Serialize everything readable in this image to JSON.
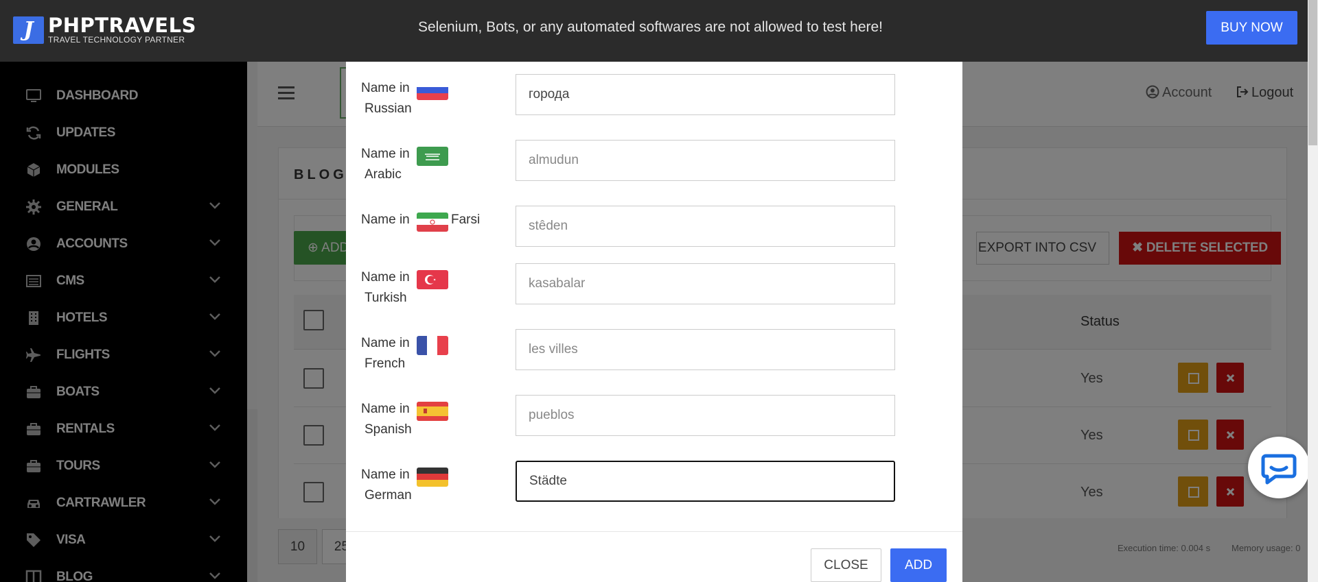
{
  "topbar": {
    "logo_glyph": "J",
    "brand": "PHPTRAVELS",
    "tagline": "TRAVEL TECHNOLOGY PARTNER",
    "notice": "Selenium, Bots, or any automated softwares are not allowed to test here!",
    "buy_now": "BUY NOW"
  },
  "sidebar": {
    "items": [
      {
        "label": "DASHBOARD",
        "icon": "monitor-icon",
        "chevron": false
      },
      {
        "label": "UPDATES",
        "icon": "refresh-icon",
        "chevron": false
      },
      {
        "label": "MODULES",
        "icon": "cube-icon",
        "chevron": false
      },
      {
        "label": "GENERAL",
        "icon": "gear-icon",
        "chevron": true
      },
      {
        "label": "ACCOUNTS",
        "icon": "user-circle-icon",
        "chevron": true
      },
      {
        "label": "CMS",
        "icon": "list-icon",
        "chevron": true
      },
      {
        "label": "HOTELS",
        "icon": "building-icon",
        "chevron": true
      },
      {
        "label": "FLIGHTS",
        "icon": "plane-icon",
        "chevron": true
      },
      {
        "label": "BOATS",
        "icon": "briefcase-icon",
        "chevron": true
      },
      {
        "label": "RENTALS",
        "icon": "briefcase-icon",
        "chevron": true
      },
      {
        "label": "TOURS",
        "icon": "briefcase-icon",
        "chevron": true
      },
      {
        "label": "CARTRAWLER",
        "icon": "car-icon",
        "chevron": true
      },
      {
        "label": "VISA",
        "icon": "tag-icon",
        "chevron": true
      },
      {
        "label": "BLOG",
        "icon": "columns-icon",
        "chevron": true
      }
    ]
  },
  "header": {
    "account": "Account",
    "logout": "Logout"
  },
  "page": {
    "card_title": "BLOG",
    "add_label": "ADD",
    "export_label": "EXPORT INTO CSV",
    "delete_selected": "DELETE SELECTED",
    "status_header": "Status",
    "rows": [
      {
        "status": "Yes"
      },
      {
        "status": "Yes"
      },
      {
        "status": "Yes"
      }
    ],
    "pagination": [
      "10",
      "25"
    ],
    "execution_time": "Execution time: 0.004 s",
    "memory_usage": "Memory usage: 0"
  },
  "modal": {
    "name_in": "Name in",
    "languages": [
      {
        "name": "Russian",
        "flag": "russia-flag",
        "value": "города",
        "placeholder": "",
        "inline": false,
        "focused": false
      },
      {
        "name": "Arabic",
        "flag": "saudi-flag",
        "value": "",
        "placeholder": "almudun",
        "inline": false,
        "focused": false
      },
      {
        "name": "Farsi",
        "flag": "iran-flag",
        "value": "",
        "placeholder": "stêden",
        "inline": true,
        "focused": false
      },
      {
        "name": "Turkish",
        "flag": "turkey-flag",
        "value": "",
        "placeholder": "kasabalar",
        "inline": false,
        "focused": false
      },
      {
        "name": "French",
        "flag": "france-flag",
        "value": "",
        "placeholder": "les villes",
        "inline": false,
        "focused": false
      },
      {
        "name": "Spanish",
        "flag": "spain-flag",
        "value": "",
        "placeholder": "pueblos",
        "inline": false,
        "focused": false
      },
      {
        "name": "German",
        "flag": "germany-flag",
        "value": "Städte",
        "placeholder": "",
        "inline": false,
        "focused": true
      }
    ],
    "close_label": "CLOSE",
    "add_label": "ADD"
  },
  "colors": {
    "topbar_bg": "#2b2b2b",
    "primary_blue": "#3b6cf2",
    "danger_red": "#d01313",
    "success_green": "#4aa64a",
    "warning_orange": "#e39f17"
  }
}
